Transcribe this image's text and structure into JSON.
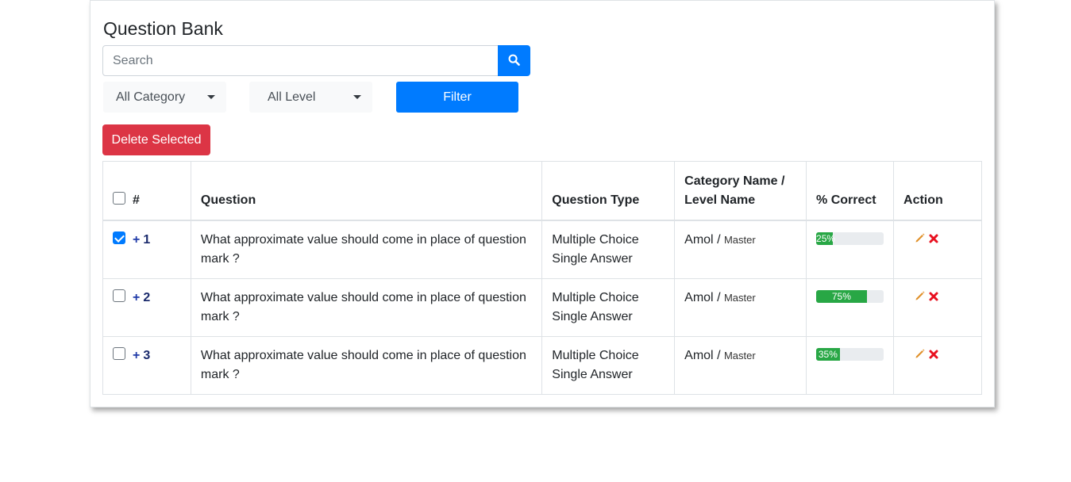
{
  "page": {
    "title": "Question Bank",
    "search_placeholder": "Search",
    "category_select": "All Category",
    "level_select": "All Level",
    "filter_label": "Filter",
    "delete_label": "Delete Selected"
  },
  "table": {
    "headers": {
      "number": "#",
      "question": "Question",
      "type": "Question Type",
      "category_line1": "Category Name /",
      "category_line2": "Level Name",
      "correct": "% Correct",
      "action": "Action"
    },
    "rows": [
      {
        "checked": true,
        "plus": "+",
        "number": "1",
        "question": "What approximate value should come in place of question mark ?",
        "type_line1": "Multiple Choice",
        "type_line2": "Single Answer",
        "category": "Amol",
        "separator": "/",
        "level": "Master",
        "percent_label": "25%",
        "percent": 25
      },
      {
        "checked": false,
        "plus": "+",
        "number": "2",
        "question": "What approximate value should come in place of question mark ?",
        "type_line1": "Multiple Choice",
        "type_line2": "Single Answer",
        "category": "Amol",
        "separator": "/",
        "level": "Master",
        "percent_label": "75%",
        "percent": 75
      },
      {
        "checked": false,
        "plus": "+",
        "number": "3",
        "question": "What approximate value should come in place of question mark ?",
        "type_line1": "Multiple Choice",
        "type_line2": "Single Answer",
        "category": "Amol",
        "separator": "/",
        "level": "Master",
        "percent_label": "35%",
        "percent": 35
      }
    ]
  },
  "icons": {
    "search": "search-icon",
    "edit": "pencil-icon",
    "delete": "close-icon",
    "caret": "caret-down-icon"
  },
  "colors": {
    "primary": "#007bff",
    "danger": "#dc3545",
    "success": "#28a745",
    "edit_icon": "#e0902a",
    "delete_icon": "#e8101f"
  }
}
